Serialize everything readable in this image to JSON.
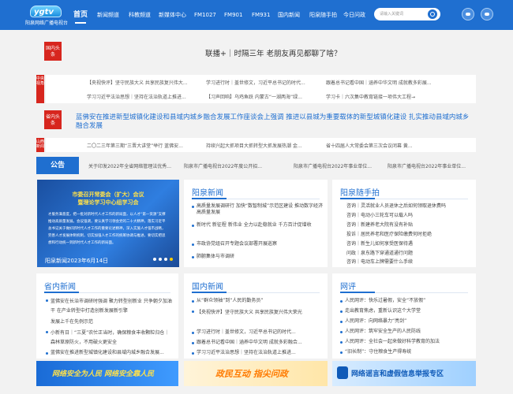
{
  "header": {
    "logo_text": "ygtv",
    "logo_sub": "阳泉网络广播电视台",
    "nav": [
      "首页",
      "新闻频道",
      "科教频道",
      "新媒体中心",
      "FM1027",
      "FM901",
      "FM931",
      "国内新闻",
      "阳泉随手拍",
      "今日问政"
    ],
    "search_placeholder": "请输入关键词",
    "social_icons": [
      "weibo-icon",
      "wechat-icon"
    ],
    "color": "#1f6fd0"
  },
  "headline1": {
    "badge": "国内头条",
    "title": "联播+｜时隔三年 老朋友再见都聊了啥？"
  },
  "row1": {
    "label": "中央视角",
    "items": [
      "【央视快评】坚守民族大义 共享民族复兴伟大...",
      "学习进行时｜盖世修文，习近平总书记的时代...",
      "跟着总书记看中国｜涵养中华文明 成就教多彩展..."
    ]
  },
  "row2": {
    "items": [
      "学习习近平法治思想｜坚持在法治轨道上推进...",
      "【习声回响】乌鸡鱼跃 内蒙古“一湖两海”绿...",
      "学习卡｜六次集中教育链接一项伟大工程→"
    ]
  },
  "headline2": {
    "badge": "省内头条",
    "title": "蓝佛安在推进新型城镇化建设和县域内城乡融合发展工作座谈会上强调 推进以县城为重要载体的新型城镇化建设 扎实推动县域内城乡融合发展"
  },
  "row3": {
    "label": "山西新闻",
    "items": [
      "二〇二三年第三期“三晋大讲堂”举行 蓝佛安...",
      "持续兴起大抓项目大抓转型大抓发展热潮 金...",
      "省十四届人大常委会第三次会议闭幕 黄..."
    ]
  },
  "notice": {
    "label": "公告",
    "items": [
      "关于印发2022年全省网络管理法优秀...",
      "阳泉市广播电视台2022年度公开招...",
      "阳泉市广播电视台2022年事业单位...",
      "阳泉市广播电视台2022年事业单位..."
    ]
  },
  "slide": {
    "title1": "市委召开常委会（扩大）会议",
    "title2": "暨理论学习中心组学习会",
    "body": "才服务满意度，把一批对新时代人才工作的新局面，以人才“第一资源”支撑推动高质量发展。会议强调，要认真学习领会党的二十大精神，落实习近平总书记关于做好新时代人才工作的重要论述精神，深入实施人才强市战略，完善人才发展体制机制，切实加强人才工作的统筹协调与推进，要切实把思想和行动统一到新时代人才工作的新局面。",
    "caption": "阳泉新闻2023年6月14日"
  },
  "yq_news": {
    "title": "阳泉新闻",
    "items": [
      "高质量发展调研行 加快“数智制城”示范区建设 推动数字经济高质量发展",
      "新时代 新征程 新伟业 全力以赴稳就业 千方百计促增收",
      "市政协党组召开专题会议部署开展巡察",
      "肺腑集体与市调研"
    ]
  },
  "ss_photo": {
    "title": "阳泉随手拍",
    "items": [
      "咨询｜灵活就业人员退休之后如何领取退休费吗",
      "咨询｜电动小三轮车可以载人吗",
      "咨询｜新建养老大院有没有补贴",
      "投诉｜居民养老和医疗保险缴费何时拒绝",
      "咨询｜新生儿如何享受医保待遇",
      "问政｜泉东路下穿通道通行问题",
      "咨询｜电动车上牌需要什么手续"
    ]
  },
  "local_news": {
    "title": "省内新闻",
    "items": [
      "蓝佛安在长治市调研时强调 聚力转型创新业 只争朝夕加油干 在产业转型中打造创新发展新引擎",
      "发展上千在先例示范",
      "小新有日｜“三夏”农忙正当时，确保粮食丰收颗粒归仓｜森林草原防火，不用破火更安全",
      "蓝佛安在推进新型城镇化建设和县域内城乡融合发展..."
    ]
  },
  "china_news": {
    "title": "国内新闻",
    "items": [
      "从“群众领袖”到“人民的勤务员”",
      "【央视快评】坚守民族大义 共享民族复兴伟大荣光",
      "学习进行时｜盖世修文，习近平总书记的时代...",
      "跟着总书记看中国｜涵养中华文明 成就多彩融合...",
      "学习习近平法治思想｜坚持在法治轨道上推进..."
    ]
  },
  "review": {
    "title": "网评",
    "items": [
      "人民网评：快乐过暑假，安全“不放假”",
      "走出教育焦虑，重新认识这个大学堂",
      "人民网评：向网络暴力“亮剑”",
      "人民网评：筑牢安全生产的人民防线",
      "人民网评：全社会一起来做好科学教育的加法",
      "“旧长制”：守住粮食生产得寿统"
    ]
  },
  "banners": [
    {
      "text": "网络安全为人民 网络安全靠人民",
      "color": "#1a6bd6"
    },
    {
      "text": "政民互动 指尖问政",
      "color": "#ff7a00"
    },
    {
      "text": "网络谣言和虚假信息举报专区",
      "color": "#0f5ab8"
    }
  ]
}
